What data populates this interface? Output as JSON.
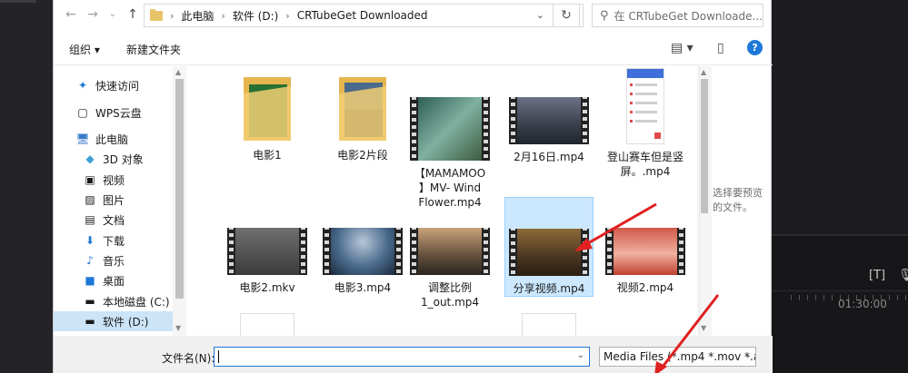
{
  "address": {
    "crumbs": [
      "此电脑",
      "软件 (D:)",
      "CRTubeGet Downloaded"
    ],
    "search_placeholder": "在 CRTubeGet Downloade..."
  },
  "toolbar": {
    "organize": "组织 ▾",
    "new_folder": "新建文件夹"
  },
  "nav": {
    "items": [
      {
        "label": "快速访问",
        "icon": "pin-icon"
      },
      {
        "label": "WPS云盘",
        "icon": "cloud-doc-icon"
      },
      {
        "label": "此电脑",
        "icon": "computer-icon"
      },
      {
        "label": "3D 对象",
        "icon": "cube-icon"
      },
      {
        "label": "视频",
        "icon": "video-icon"
      },
      {
        "label": "图片",
        "icon": "picture-icon"
      },
      {
        "label": "文档",
        "icon": "document-icon"
      },
      {
        "label": "下载",
        "icon": "download-icon"
      },
      {
        "label": "音乐",
        "icon": "music-icon"
      },
      {
        "label": "桌面",
        "icon": "desktop-icon"
      },
      {
        "label": "本地磁盘 (C:)",
        "icon": "drive-icon"
      },
      {
        "label": "软件 (D:)",
        "icon": "drive-icon"
      }
    ],
    "selected": "软件 (D:)"
  },
  "files": [
    {
      "name": "电影1",
      "kind": "folder"
    },
    {
      "name": "电影2片段",
      "kind": "folder"
    },
    {
      "name": "【MAMAMOO】MV- Wind Flower.mp4",
      "line1": "【MAMAMOO",
      "line2": "】MV- Wind",
      "line3": "Flower.mp4",
      "kind": "video"
    },
    {
      "name": "2月16日.mp4",
      "kind": "video"
    },
    {
      "name": "登山赛车但是竖屏。.mp4",
      "line1": "登山赛车但是竖",
      "line2": "屏。.mp4",
      "kind": "image"
    },
    {
      "name": "电影2.mkv",
      "kind": "video"
    },
    {
      "name": "电影3.mp4",
      "kind": "video"
    },
    {
      "name": "调整比例1_out.mp4",
      "line1": "调整比例",
      "line2": "1_out.mp4",
      "kind": "video"
    },
    {
      "name": "分享视频.mp4",
      "kind": "video",
      "selected": true
    },
    {
      "name": "视频2.mp4",
      "kind": "video"
    }
  ],
  "preview": {
    "text": "选择要预览的文件。"
  },
  "bottom": {
    "filename_label": "文件名(N):",
    "filename_value": "",
    "filter": "Media Files (*.mp4 *.mov *.a"
  },
  "background": {
    "timecode": "01:30:00"
  },
  "colors": {
    "accent": "#1e78d7",
    "selection": "#cce8ff",
    "arrow": "#e02020"
  }
}
